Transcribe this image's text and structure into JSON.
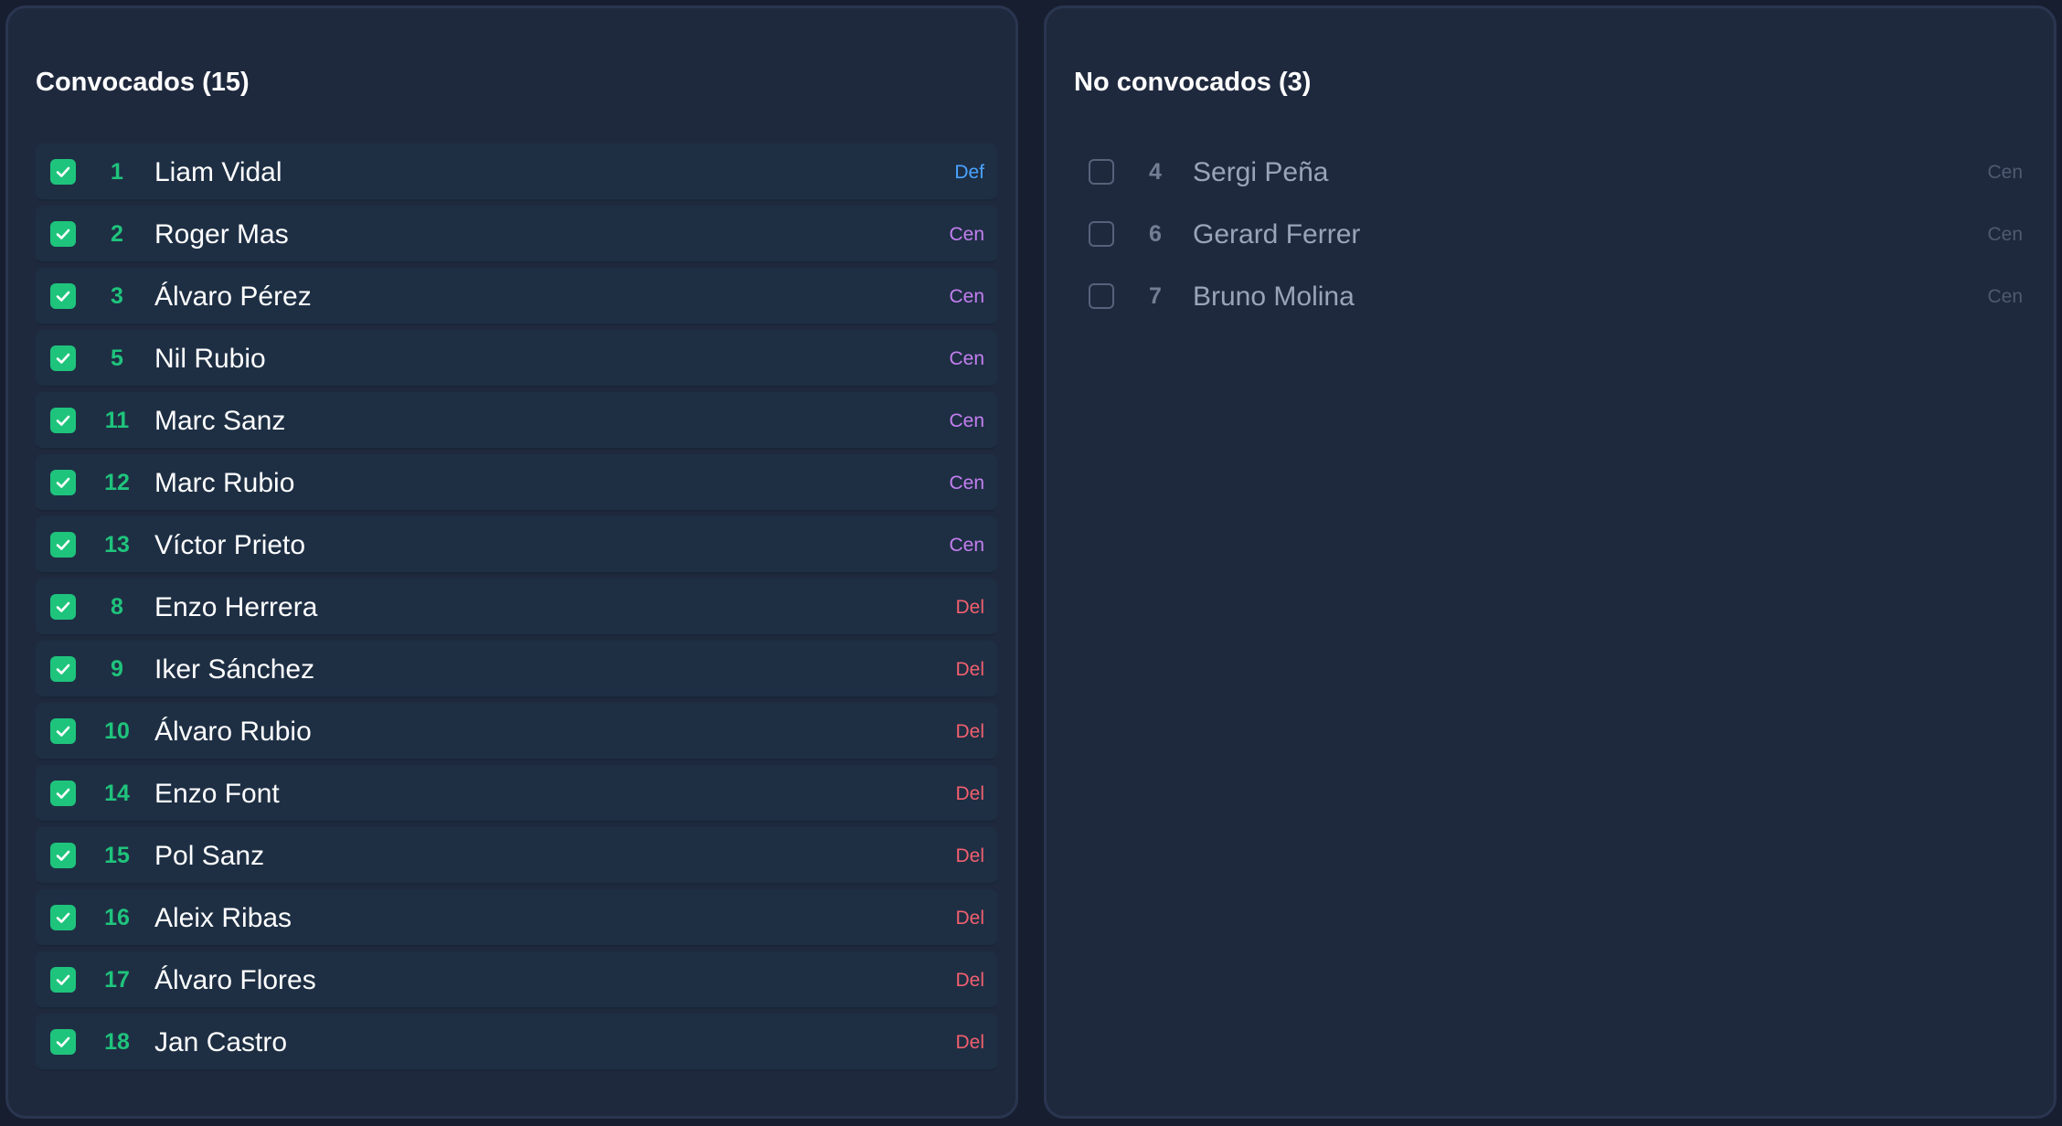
{
  "selected_panel": {
    "title": "Convocados (15)",
    "players": [
      {
        "number": "1",
        "name": "Liam Vidal",
        "position": "Def"
      },
      {
        "number": "2",
        "name": "Roger Mas",
        "position": "Cen"
      },
      {
        "number": "3",
        "name": "Álvaro Pérez",
        "position": "Cen"
      },
      {
        "number": "5",
        "name": "Nil Rubio",
        "position": "Cen"
      },
      {
        "number": "11",
        "name": "Marc Sanz",
        "position": "Cen"
      },
      {
        "number": "12",
        "name": "Marc Rubio",
        "position": "Cen"
      },
      {
        "number": "13",
        "name": "Víctor Prieto",
        "position": "Cen"
      },
      {
        "number": "8",
        "name": "Enzo Herrera",
        "position": "Del"
      },
      {
        "number": "9",
        "name": "Iker Sánchez",
        "position": "Del"
      },
      {
        "number": "10",
        "name": "Álvaro Rubio",
        "position": "Del"
      },
      {
        "number": "14",
        "name": "Enzo Font",
        "position": "Del"
      },
      {
        "number": "15",
        "name": "Pol Sanz",
        "position": "Del"
      },
      {
        "number": "16",
        "name": "Aleix Ribas",
        "position": "Del"
      },
      {
        "number": "17",
        "name": "Álvaro Flores",
        "position": "Del"
      },
      {
        "number": "18",
        "name": "Jan Castro",
        "position": "Del"
      }
    ]
  },
  "unselected_panel": {
    "title": "No convocados (3)",
    "players": [
      {
        "number": "4",
        "name": "Sergi Peña",
        "position": "Cen"
      },
      {
        "number": "6",
        "name": "Gerard Ferrer",
        "position": "Cen"
      },
      {
        "number": "7",
        "name": "Bruno Molina",
        "position": "Cen"
      }
    ]
  },
  "colors": {
    "accent_green": "#1fc47c",
    "position_def": "#4aa3ff",
    "position_cen": "#c47ff0",
    "position_del": "#f25f6e"
  },
  "icons": {
    "checked": "check-icon"
  }
}
